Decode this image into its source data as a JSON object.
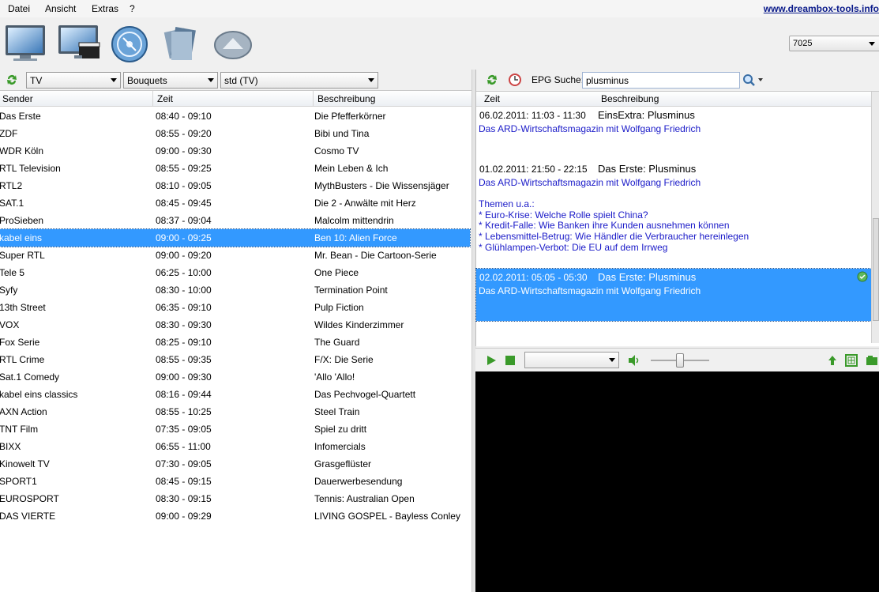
{
  "menu": [
    "Datei",
    "Ansicht",
    "Extras",
    "?"
  ],
  "site_link": "www.dreambox-tools.info",
  "toolbar_icons": [
    "tv-icon",
    "movie-icon",
    "disc-icon",
    "files-icon",
    "eject-icon"
  ],
  "receiver": {
    "value": "7025"
  },
  "filters": {
    "type": "TV",
    "bouquets": "Bouquets",
    "list": "std (TV)"
  },
  "channel_table": {
    "columns": [
      "Sender",
      "Zeit",
      "Beschreibung"
    ],
    "rows": [
      {
        "sender": "Das Erste",
        "zeit": "08:40 - 09:10",
        "beschreibung": "Die Pfefferkörner"
      },
      {
        "sender": "ZDF",
        "zeit": "08:55 - 09:20",
        "beschreibung": "Bibi und Tina"
      },
      {
        "sender": "WDR Köln",
        "zeit": "09:00 - 09:30",
        "beschreibung": "Cosmo TV"
      },
      {
        "sender": "RTL Television",
        "zeit": "08:55 - 09:25",
        "beschreibung": "Mein Leben & Ich"
      },
      {
        "sender": "RTL2",
        "zeit": "08:10 - 09:05",
        "beschreibung": "MythBusters - Die Wissensjäger"
      },
      {
        "sender": "SAT.1",
        "zeit": "08:45 - 09:45",
        "beschreibung": "Die 2 - Anwälte mit Herz"
      },
      {
        "sender": "ProSieben",
        "zeit": "08:37 - 09:04",
        "beschreibung": "Malcolm mittendrin"
      },
      {
        "sender": "kabel eins",
        "zeit": "09:00 - 09:25",
        "beschreibung": "Ben 10: Alien Force"
      },
      {
        "sender": "Super RTL",
        "zeit": "09:00 - 09:20",
        "beschreibung": "Mr. Bean - Die Cartoon-Serie"
      },
      {
        "sender": "Tele 5",
        "zeit": "06:25 - 10:00",
        "beschreibung": "One Piece"
      },
      {
        "sender": "Syfy",
        "zeit": "08:30 - 10:00",
        "beschreibung": "Termination Point"
      },
      {
        "sender": "13th Street",
        "zeit": "06:35 - 09:10",
        "beschreibung": "Pulp Fiction"
      },
      {
        "sender": "VOX",
        "zeit": "08:30 - 09:30",
        "beschreibung": "Wildes Kinderzimmer"
      },
      {
        "sender": "Fox Serie",
        "zeit": "08:25 - 09:10",
        "beschreibung": "The Guard"
      },
      {
        "sender": "RTL Crime",
        "zeit": "08:55 - 09:35",
        "beschreibung": "F/X: Die Serie"
      },
      {
        "sender": "Sat.1 Comedy",
        "zeit": "09:00 - 09:30",
        "beschreibung": "'Allo 'Allo!"
      },
      {
        "sender": "kabel eins classics",
        "zeit": "08:16 - 09:44",
        "beschreibung": "Das Pechvogel-Quartett"
      },
      {
        "sender": "AXN Action",
        "zeit": "08:55 - 10:25",
        "beschreibung": "Steel Train"
      },
      {
        "sender": "TNT Film",
        "zeit": "07:35 - 09:05",
        "beschreibung": "Spiel zu dritt"
      },
      {
        "sender": "BIXX",
        "zeit": "06:55 - 11:00",
        "beschreibung": "Infomercials"
      },
      {
        "sender": "Kinowelt TV",
        "zeit": "07:30 - 09:05",
        "beschreibung": "Grasgeflüster"
      },
      {
        "sender": "SPORT1",
        "zeit": "08:45 - 09:15",
        "beschreibung": "Dauerwerbesendung"
      },
      {
        "sender": "EUROSPORT",
        "zeit": "08:30 - 09:15",
        "beschreibung": "Tennis: Australian Open"
      },
      {
        "sender": "DAS VIERTE",
        "zeit": "09:00 - 09:29",
        "beschreibung": "LIVING GOSPEL - Bayless Conley"
      }
    ]
  },
  "epg": {
    "search_label": "EPG Suche:",
    "search_value": "plusminus",
    "columns": [
      "Zeit",
      "Beschreibung"
    ],
    "entries": [
      {
        "time": "06.02.2011: 11:03 - 11:30",
        "title": "EinsExtra: Plusminus",
        "lines": [
          "Das ARD-Wirtschaftsmagazin mit Wolfgang Friedrich"
        ]
      },
      {
        "time": "01.02.2011: 21:50 - 22:15",
        "title": "Das Erste: Plusminus",
        "lines": [
          "Das ARD-Wirtschaftsmagazin mit Wolfgang Friedrich",
          "",
          "Themen u.a.:",
          "* Euro-Krise: Welche Rolle spielt China?",
          "* Kredit-Falle: Wie Banken ihre Kunden ausnehmen können",
          "* Lebensmittel-Betrug: Wie Händler die Verbraucher hereinlegen",
          "* Glühlampen-Verbot: Die EU auf dem Irrweg"
        ]
      },
      {
        "time": "02.02.2011: 05:05 - 05:30",
        "title": "Das Erste: Plusminus",
        "lines": [
          "Das ARD-Wirtschaftsmagazin mit Wolfgang Friedrich"
        ]
      }
    ]
  },
  "player": {
    "stream_value": ""
  },
  "colors": {
    "selection": "#3399ff",
    "epg_text": "#1a1ac8"
  }
}
